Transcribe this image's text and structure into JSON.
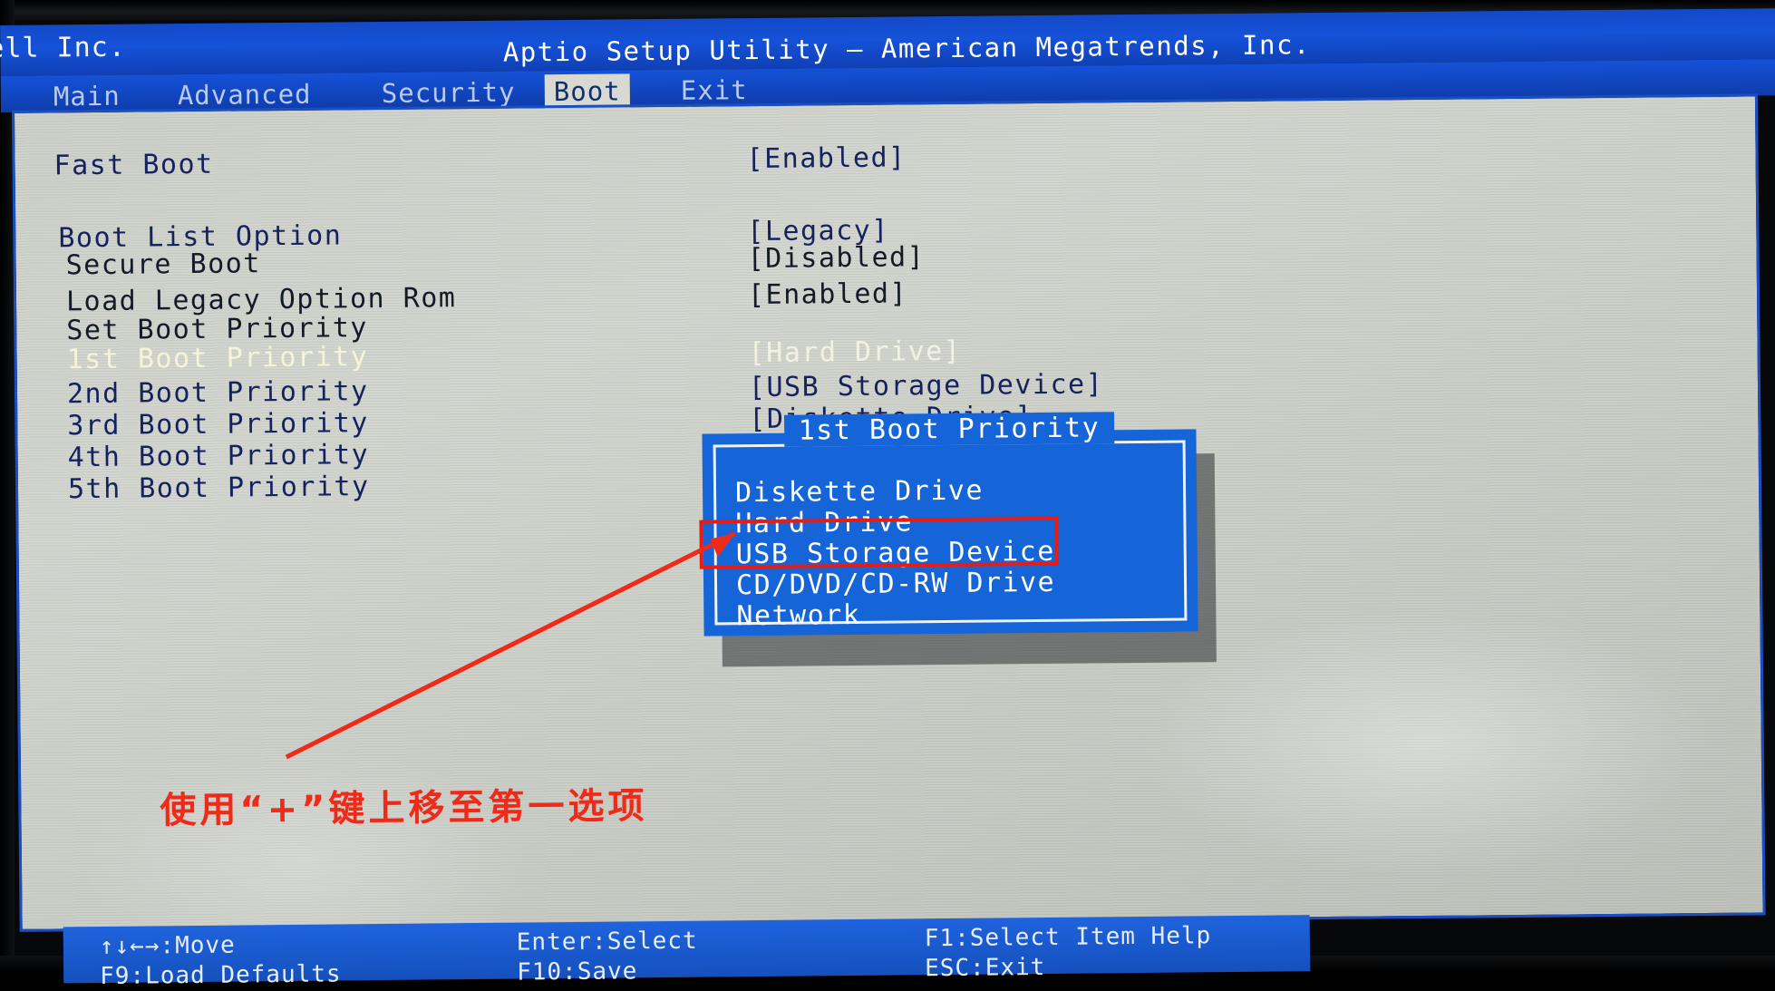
{
  "header": {
    "vendor": "ell Inc.",
    "app_title": "Aptio Setup Utility – American Megatrends, Inc.",
    "menu": [
      {
        "label": "Main",
        "active": false
      },
      {
        "label": "Advanced",
        "active": false
      },
      {
        "label": "Security",
        "active": false
      },
      {
        "label": "Boot",
        "active": true
      },
      {
        "label": "Exit",
        "active": false
      }
    ]
  },
  "settings": [
    {
      "label": "Fast Boot",
      "value": "[Enabled]",
      "state": "normal"
    },
    {
      "label": "Boot List Option",
      "value": "[Legacy]",
      "state": "normal"
    },
    {
      "label": "Secure Boot",
      "value": "[Disabled]",
      "state": "dim"
    },
    {
      "label": "Load Legacy Option Rom",
      "value": "[Enabled]",
      "state": "dim"
    },
    {
      "label": "Set Boot Priority",
      "value": "",
      "state": "dim"
    },
    {
      "label": "1st Boot Priority",
      "value": "[Hard Drive]",
      "state": "selected"
    },
    {
      "label": "2nd Boot Priority",
      "value": "[USB Storage Device]",
      "state": "normal"
    },
    {
      "label": "3rd Boot Priority",
      "value": "[Diskette Drive]",
      "state": "normal"
    },
    {
      "label": "4th Boot Priority",
      "value": "",
      "state": "normal"
    },
    {
      "label": "5th Boot Priority",
      "value": "",
      "state": "normal"
    }
  ],
  "dialog": {
    "title": "1st Boot Priority",
    "options": [
      {
        "label": "Diskette Drive",
        "highlighted": false
      },
      {
        "label": "Hard Drive",
        "highlighted": false
      },
      {
        "label": "USB Storage Device",
        "highlighted": true
      },
      {
        "label": "CD/DVD/CD-RW Drive",
        "highlighted": false
      },
      {
        "label": "Network",
        "highlighted": false
      }
    ]
  },
  "annotation": {
    "note": "使用“+”键上移至第一选项",
    "color": "#ef2a18"
  },
  "hints": [
    {
      "text": "↑↓←→:Move",
      "col": 0,
      "row": 0
    },
    {
      "text": "Enter:Select",
      "col": 1,
      "row": 0
    },
    {
      "text": "F1:Select Item Help",
      "col": 2,
      "row": 0
    },
    {
      "text": "F9:Load Defaults",
      "col": 0,
      "row": 1
    },
    {
      "text": "F10:Save",
      "col": 1,
      "row": 1
    },
    {
      "text": "ESC:Exit",
      "col": 2,
      "row": 1
    }
  ],
  "colors": {
    "bios_blue": "#1552d8",
    "panel_grey": "#cfd2cb",
    "text_navy": "#15225e",
    "selected_text": "#f7f3d8",
    "annotation_red": "#e81c14"
  }
}
